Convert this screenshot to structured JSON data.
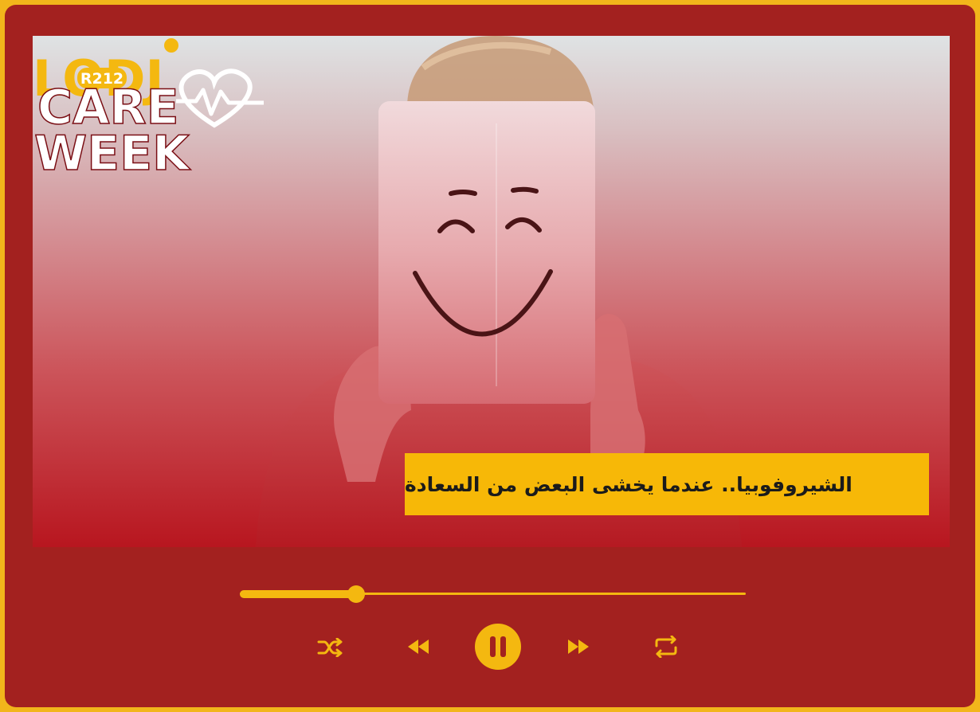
{
  "colors": {
    "panel": "#a3211f",
    "accent": "#f4b810",
    "frame": "#f2b51b"
  },
  "cover": {
    "logo_text": "LODJ",
    "logo_badge": "R212",
    "show_title_line1": "CARE",
    "show_title_line2": "WEEK",
    "headline": "الشيروفوبيا.. عندما يخشى البعض من السعادة"
  },
  "player": {
    "progress_fraction": 0.23,
    "state": "playing",
    "controls": {
      "shuffle_icon": "shuffle-icon",
      "previous_icon": "rewind-icon",
      "pause_icon": "pause-icon",
      "next_icon": "fast-forward-icon",
      "repeat_icon": "repeat-icon"
    }
  }
}
